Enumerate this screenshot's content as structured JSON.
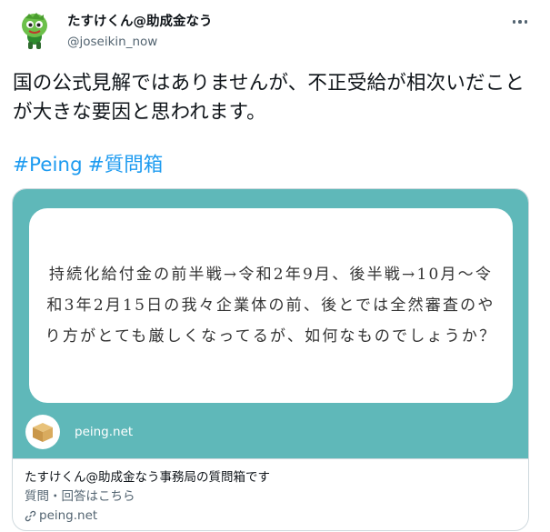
{
  "author": {
    "display_name": "たすけくん@助成金なう",
    "handle": "@joseikin_now"
  },
  "tweet": {
    "text": "国の公式見解ではありませんが、不正受給が相次いだことが大きな要因と思われます。",
    "hashtags": [
      "#Peing",
      "#質問箱"
    ]
  },
  "card": {
    "question": "持続化給付金の前半戦→令和2年9月、後半戦→10月〜令和3年2月15日の我々企業体の前、後とでは全然審査のやり方がとても厳しくなってるが、如何なものでしょうか？",
    "brand_label": "peing.net",
    "title": "たすけくん@助成金なう事務局の質問箱です",
    "description": "質問・回答はこちら",
    "domain": "peing.net"
  },
  "icons": {
    "more": "more-horizontal-icon",
    "link": "link-icon",
    "box": "cardboard-box-icon",
    "avatar": "green-mascot-avatar"
  },
  "colors": {
    "accent": "#1d9bf0",
    "card_background": "#5fb8b9",
    "secondary_text": "#536471",
    "border": "#cfd9de"
  }
}
